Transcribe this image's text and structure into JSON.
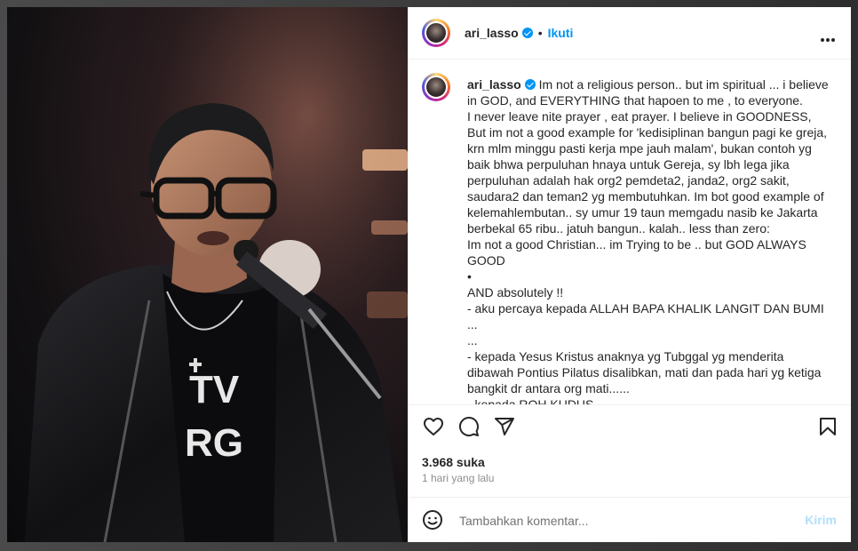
{
  "post": {
    "username": "ari_lasso",
    "follow_separator": "•",
    "follow_label": "Ikuti",
    "caption": "Im not a religious person.. but im spiritual ... i believe in GOD, and EVERYTHING that hapoen to me , to everyone.\nI never leave nite prayer , eat prayer. I believe in GOODNESS, But im not a good example for 'kedisiplinan bangun pagi ke greja, krn mlm minggu pasti kerja mpe jauh malam', bukan contoh yg baik bhwa perpuluhan hnaya untuk Gereja, sy lbh lega jika perpuluhan adalah hak org2 pemdeta2, janda2, org2 sakit, saudara2 dan teman2 yg membutuhkan. Im bot good example of kelemahlembutan.. sy umur 19 taun memgadu nasib ke Jakarta berbekal 65 ribu.. jatuh bangun.. kalah.. less than zero:\nIm not a good Christian... im Trying to be .. but GOD ALWAYS GOOD\n•\nAND absolutely !!\n- aku percaya kepada ALLAH BAPA KHALIK LANGIT DAN BUMI ...\n...\n- kepada Yesus Kristus anaknya yg Tubggal yg menderita dibawah Pontius Pilatus disalibkan, mati dan pada hari yg ketiga bangkit dr antara org mati......\n- kepada ROH KUDUS\nGereja yg kudus dan am , persekutuan org kudus",
    "likes": "3.968 suka",
    "time": "1 hari yang lalu",
    "comment_placeholder": "Tambahkan komentar...",
    "post_button": "Kirim"
  },
  "icons": {
    "verified": "verified-badge-icon",
    "more": "more-options-icon",
    "like": "heart-icon",
    "comment": "comment-icon",
    "share": "paper-plane-icon",
    "save": "bookmark-icon",
    "emoji": "emoji-icon"
  },
  "colors": {
    "accent": "#0095f6",
    "post_button_disabled": "#b2dffc",
    "secondary_text": "#8e8e8e"
  }
}
